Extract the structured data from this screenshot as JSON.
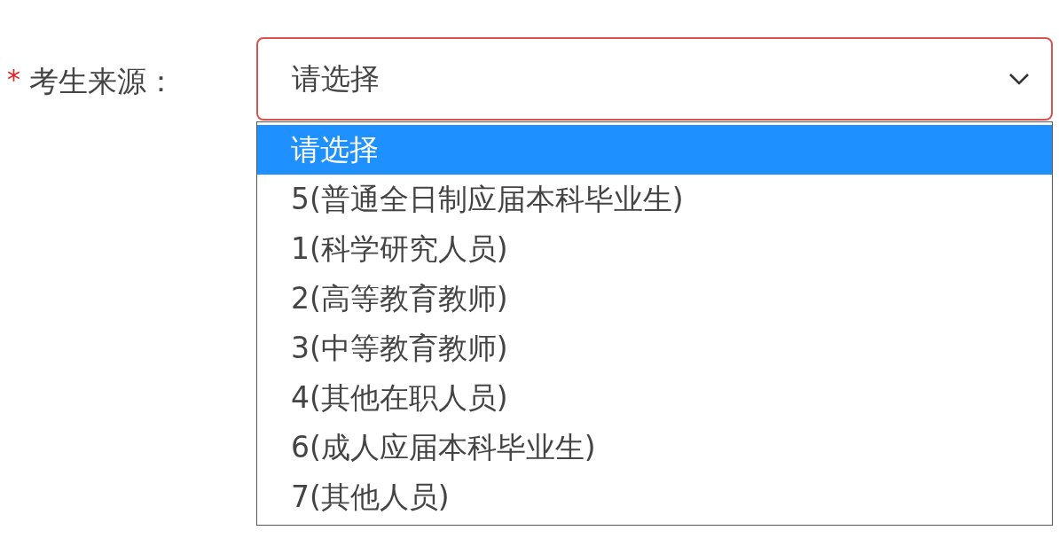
{
  "field": {
    "required_mark": "*",
    "label": "考生来源：",
    "value": "请选择",
    "invalid": true
  },
  "dropdown": {
    "options": [
      {
        "label": "请选择",
        "selected": true
      },
      {
        "label": "5(普通全日制应届本科毕业生)",
        "selected": false
      },
      {
        "label": "1(科学研究人员)",
        "selected": false
      },
      {
        "label": "2(高等教育教师)",
        "selected": false
      },
      {
        "label": "3(中等教育教师)",
        "selected": false
      },
      {
        "label": "4(其他在职人员)",
        "selected": false
      },
      {
        "label": "6(成人应届本科毕业生)",
        "selected": false
      },
      {
        "label": "7(其他人员)",
        "selected": false
      }
    ]
  }
}
